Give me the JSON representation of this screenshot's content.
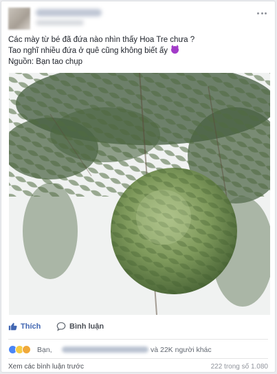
{
  "post": {
    "lines": [
      "Các mày từ bé đã đứa nào nhìn thấy Hoa Tre chưa ?",
      "Tao nghĩ nhiều đứa ở quê cũng không biết ấy",
      "Nguồn: Bạn tao chụp"
    ],
    "emoji_icon": "smiling-devil-emoji"
  },
  "actions": {
    "like_label": "Thích",
    "comment_label": "Bình luận"
  },
  "reactions": {
    "icons": [
      "like-reaction-icon",
      "wow-reaction-icon",
      "sad-reaction-icon"
    ],
    "name": "Bạn,",
    "rest": "và 22K người khác"
  },
  "footer": {
    "prev_comments": "Xem các bình luận trước",
    "count": "222 trong số 1.080"
  },
  "colors": {
    "link_blue": "#4267b2",
    "emoji_purple": "#a23bc8"
  }
}
